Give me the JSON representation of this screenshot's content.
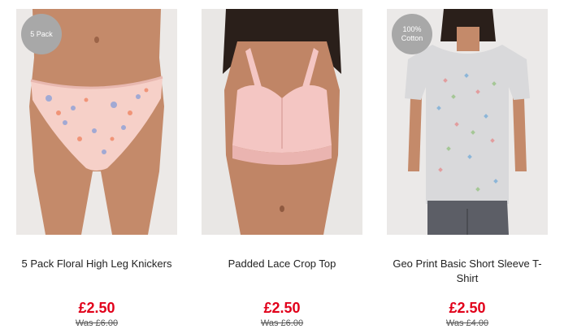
{
  "products": [
    {
      "badge": "5 Pack",
      "title": "5 Pack Floral High Leg Knickers",
      "price": "£2.50",
      "was_price": "Was £6.00"
    },
    {
      "badge": "",
      "title": "Padded Lace Crop Top",
      "price": "£2.50",
      "was_price": "Was £6.00"
    },
    {
      "badge": "100% Cotton",
      "title": "Geo Print Basic Short Sleeve T-Shirt",
      "price": "£2.50",
      "was_price": "Was £4.00"
    }
  ],
  "colors": {
    "price": "#e1001a",
    "badge_bg": "#a8a8a8",
    "photo_bg": "#ebe8e6",
    "skin": "#c48a6a",
    "pink_garment": "#f4c6c3",
    "tshirt": "#d9d9db"
  }
}
